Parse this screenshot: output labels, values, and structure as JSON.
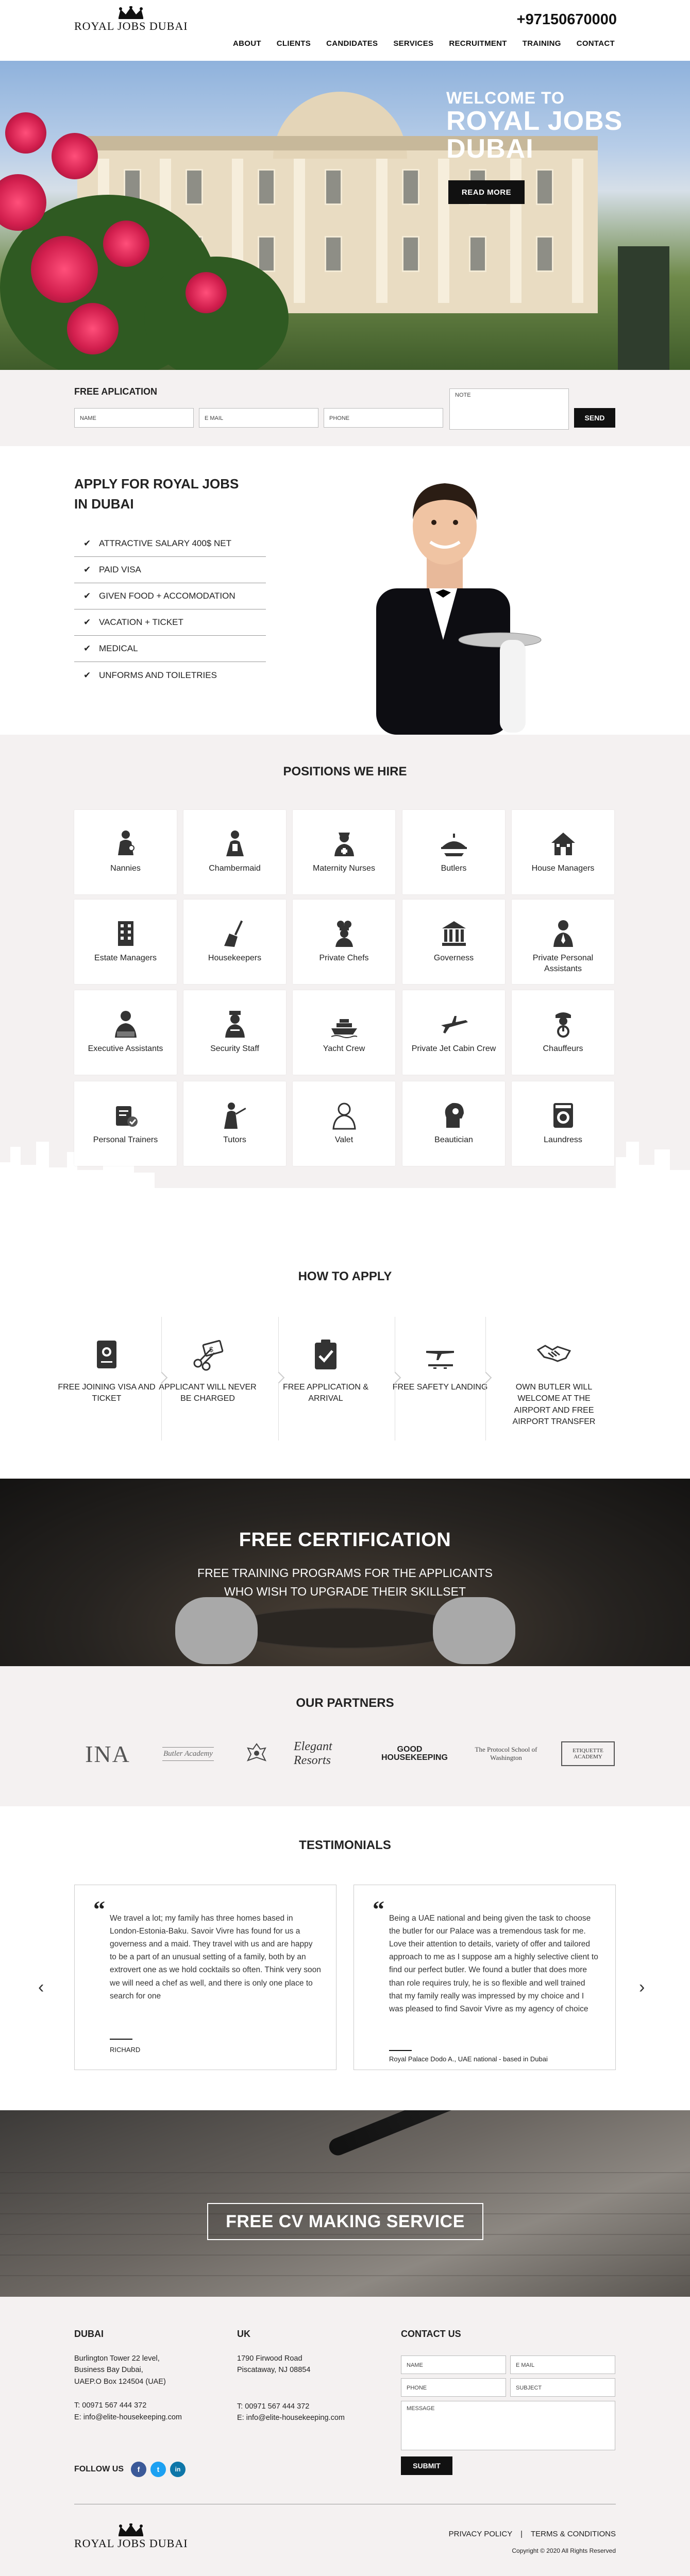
{
  "header": {
    "logo_text": "ROYAL JOBS DUBAI",
    "phone": "+97150670000",
    "nav": [
      "ABOUT",
      "CLIENTS",
      "CANDIDATES",
      "SERVICES",
      "RECRUITMENT",
      "TRAINING",
      "CONTACT"
    ]
  },
  "hero": {
    "welcome": "WELCOME TO",
    "title_line1": "ROYAL JOBS",
    "title_line2": "DUBAI",
    "button": "READ MORE"
  },
  "application": {
    "title": "FREE APLICATION",
    "name_placeholder": "NAME",
    "email_placeholder": "E MAIL",
    "phone_placeholder": "PHONE",
    "note_placeholder": "NOTE",
    "send": "SEND"
  },
  "benefits": {
    "title_line1": "APPLY FOR ROYAL JOBS",
    "title_line2": "IN DUBAI",
    "items": [
      "ATTRACTIVE SALARY 400$ NET",
      "PAID VISA",
      "GIVEN FOOD + ACCOMODATION",
      "VACATION + TICKET",
      "MEDICAL",
      "UNFORMS AND TOILETRIES"
    ]
  },
  "positions": {
    "title": "POSITIONS WE HIRE",
    "items": [
      {
        "label": "Nannies",
        "icon": "nanny-icon"
      },
      {
        "label": "Chambermaid",
        "icon": "chambermaid-icon"
      },
      {
        "label": "Maternity Nurses",
        "icon": "nurse-icon"
      },
      {
        "label": "Butlers",
        "icon": "butler-icon"
      },
      {
        "label": "House Managers",
        "icon": "house-icon"
      },
      {
        "label": "Estate Managers",
        "icon": "building-icon"
      },
      {
        "label": "Housekeepers",
        "icon": "broom-icon"
      },
      {
        "label": "Private Chefs",
        "icon": "chef-icon"
      },
      {
        "label": "Governess",
        "icon": "governess-icon"
      },
      {
        "label": "Private Personal Assistants",
        "icon": "assistant-icon"
      },
      {
        "label": "Executive Assistants",
        "icon": "executive-icon"
      },
      {
        "label": "Security Staff",
        "icon": "security-icon"
      },
      {
        "label": "Yacht Crew",
        "icon": "yacht-icon"
      },
      {
        "label": "Private Jet Cabin Crew",
        "icon": "jet-icon"
      },
      {
        "label": "Chauffeurs",
        "icon": "chauffeur-icon"
      },
      {
        "label": "Personal Trainers",
        "icon": "trainer-icon"
      },
      {
        "label": "Tutors",
        "icon": "tutor-icon"
      },
      {
        "label": "Valet",
        "icon": "valet-icon"
      },
      {
        "label": "Beautician",
        "icon": "beautician-icon"
      },
      {
        "label": "Laundress",
        "icon": "laundry-icon"
      }
    ]
  },
  "how": {
    "title": "HOW TO APPLY",
    "steps": [
      {
        "label": "FREE JOINING VISA AND TICKET",
        "icon": "passport-icon"
      },
      {
        "label": "APPLICANT WILL NEVER BE CHARGED",
        "icon": "scissors-money-icon"
      },
      {
        "label": "FREE APPLICATION & ARRIVAL",
        "icon": "clipboard-check-icon"
      },
      {
        "label": "FREE SAFETY LANDING",
        "icon": "plane-landing-icon"
      },
      {
        "label": "OWN BUTLER WILL WELCOME AT THE AIRPORT AND FREE AIRPORT TRANSFER",
        "icon": "handshake-icon"
      }
    ]
  },
  "certification": {
    "title": "FREE CERTIFICATION",
    "line1": "FREE TRAINING PROGRAMS FOR THE APPLICANTS",
    "line2": "WHO WISH TO UPGRADE THEIR SKILLSET"
  },
  "partners": {
    "title": "OUR PARTNERS",
    "logos": [
      "INA",
      "Butler Academy",
      "crest",
      "Elegant Resorts",
      "GOOD HOUSEKEEPING",
      "The Protocol School of Washington",
      "ETIQUETTE ACADEMY"
    ]
  },
  "testimonials": {
    "title": "TESTIMONIALS",
    "items": [
      {
        "text": "We travel a lot; my family has three homes based in London-Estonia-Baku. Savoir Vivre has found for us a governess and a maid. They travel with us and are happy to be a part of an unusual setting of a family, both by an extrovert one as we hold cocktails so often. Think very soon we will need a chef as well, and there is only one place to search for one",
        "author": "RICHARD"
      },
      {
        "text": "Being a UAE national and being given the task to choose the butler for our Palace was a tremendous task for me. Love their attention to details, variety of offer and tailored approach to me as I suppose am a highly selective client to find our perfect butler. We found a butler that does more than role requires truly, he is so flexible and well trained that my family really was impressed by my choice and I was pleased to find Savoir Vivre as my agency of choice",
        "author": "Royal Palace Dodo A., UAE national - based in Dubai"
      }
    ]
  },
  "cv": {
    "button": "FREE CV MAKING SERVICE"
  },
  "footer": {
    "dubai": {
      "title": "DUBAI",
      "address1": "Burlington Tower 22 level,",
      "address2": "Business Bay Dubai,",
      "address3": "UAEP.O Box 124504 (UAE)",
      "phone": "T: 00971 567 444 372",
      "email": "E:  info@elite-housekeeping.com"
    },
    "uk": {
      "title": "UK",
      "address1": "1790 Firwood Road",
      "address2": "Piscataway, NJ 08854",
      "phone": "T: 00971 567 444 372",
      "email": "E:  info@elite-housekeeping.com"
    },
    "contact": {
      "title": "CONTACT US",
      "name": "NAME",
      "email": "E MAIL",
      "phone": "PHONE",
      "subject": "SUBJECT",
      "message": "MESSAGE",
      "submit": "SUBMIT"
    },
    "follow": "FOLLOW US",
    "social": [
      "f",
      "t",
      "in"
    ],
    "privacy": "PRIVACY POLICY",
    "sep": "|",
    "terms": "TERMS & CONDITIONS",
    "copyright": "Copyright © 2020 All Rights Reserved"
  },
  "colors": {
    "accent": "#111111",
    "facebook": "#3b5998",
    "twitter": "#1da1f2",
    "linkedin": "#0e76a8",
    "section_bg": "#f4f1f1"
  }
}
